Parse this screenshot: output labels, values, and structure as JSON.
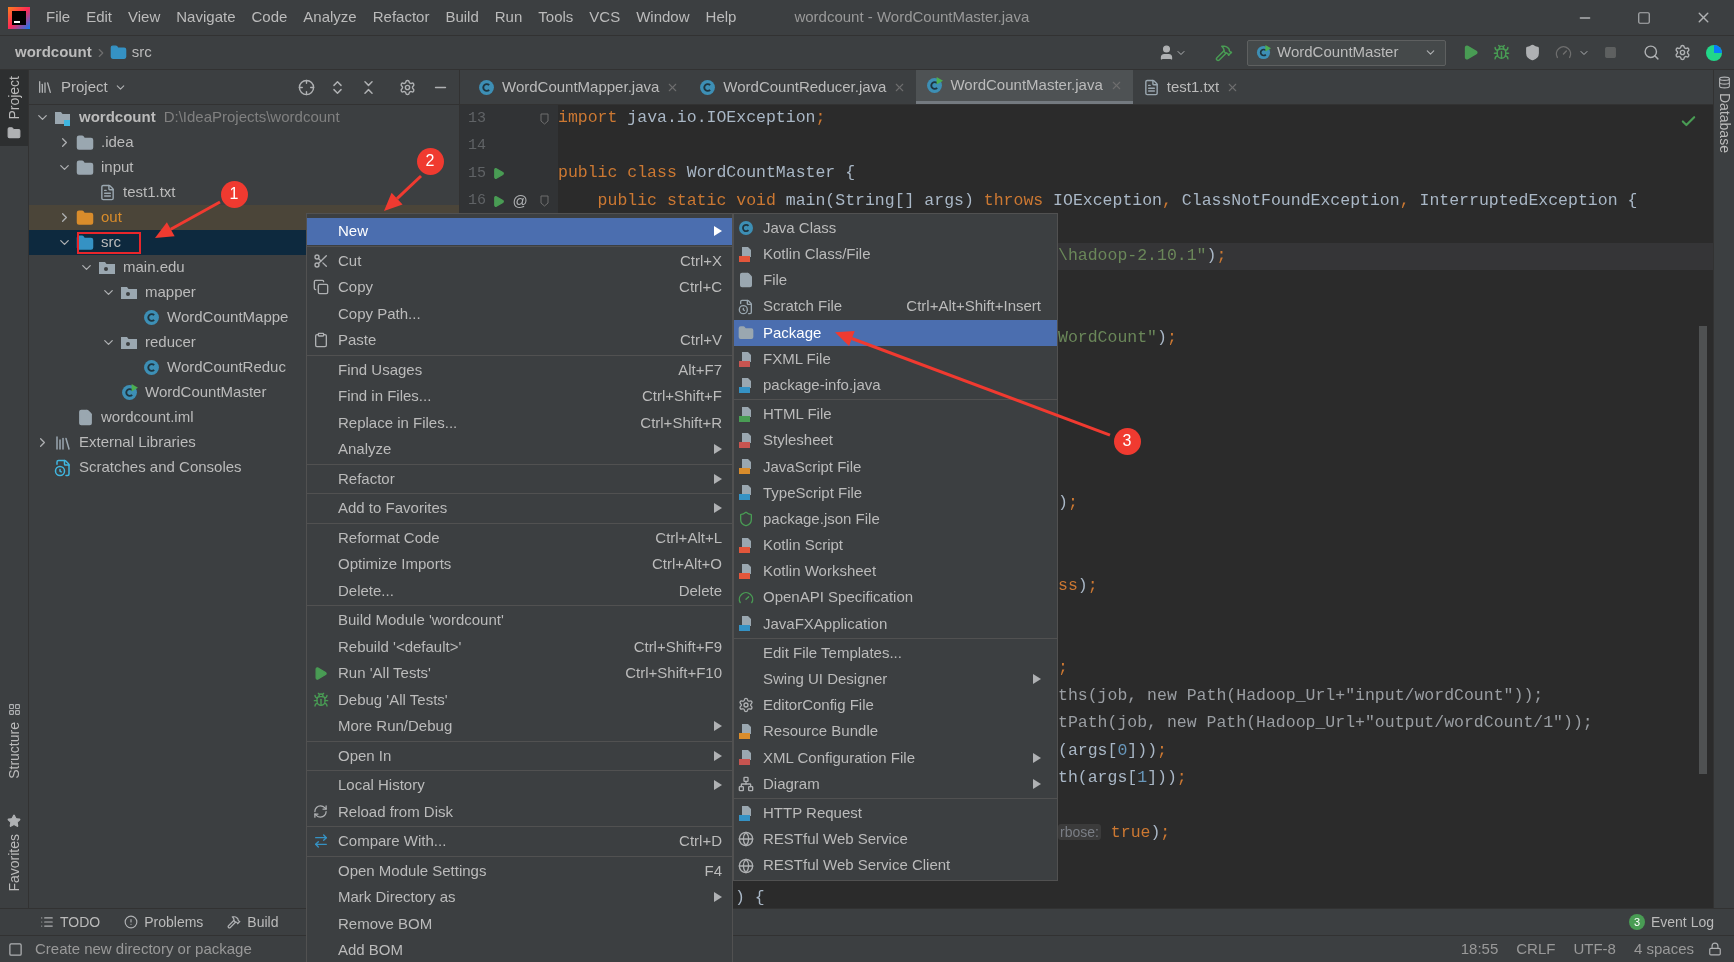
{
  "title_bar": {
    "menus": [
      "File",
      "Edit",
      "View",
      "Navigate",
      "Code",
      "Analyze",
      "Refactor",
      "Build",
      "Run",
      "Tools",
      "VCS",
      "Window",
      "Help"
    ],
    "title": "wordcount - WordCountMaster.java"
  },
  "nav_bar": {
    "breadcrumbs": [
      {
        "label": "wordcount",
        "kind": "project"
      },
      {
        "label": "src",
        "kind": "folder"
      }
    ],
    "run_config": "WordCountMaster"
  },
  "left_stripe": [
    {
      "label": "Project",
      "selected": true,
      "kind": "project"
    },
    {
      "label": "Structure",
      "selected": false,
      "kind": "structure"
    },
    {
      "label": "Favorites",
      "selected": false,
      "kind": "favorites"
    }
  ],
  "project_panel": {
    "title": "Project",
    "tree": [
      {
        "label": "wordcount",
        "path": "D:\\IdeaProjects\\wordcount",
        "kind": "module",
        "expanded": true,
        "selected": false,
        "children": [
          {
            "label": ".idea",
            "kind": "folder",
            "expanded": false,
            "selected": false
          },
          {
            "label": "input",
            "kind": "folder",
            "expanded": true,
            "selected": false,
            "children": [
              {
                "label": "test1.txt",
                "kind": "text",
                "selected": false
              }
            ]
          },
          {
            "label": "out",
            "kind": "excluded",
            "expanded": false,
            "selected": false
          },
          {
            "label": "src",
            "kind": "source",
            "expanded": true,
            "selected": true,
            "children": [
              {
                "label": "main.edu",
                "kind": "package",
                "expanded": true,
                "selected": false,
                "children": [
                  {
                    "label": "mapper",
                    "kind": "package",
                    "expanded": true,
                    "selected": false,
                    "children": [
                      {
                        "label": "WordCountMappe",
                        "kind": "class",
                        "selected": false
                      }
                    ]
                  },
                  {
                    "label": "reducer",
                    "kind": "package",
                    "expanded": true,
                    "selected": false,
                    "children": [
                      {
                        "label": "WordCountReduc",
                        "kind": "class",
                        "selected": false
                      }
                    ]
                  },
                  {
                    "label": "WordCountMaster",
                    "kind": "runclass",
                    "selected": false
                  }
                ]
              }
            ]
          },
          {
            "label": "wordcount.iml",
            "kind": "iml",
            "selected": false
          }
        ]
      },
      {
        "label": "External Libraries",
        "kind": "libraries",
        "expanded": false,
        "selected": false
      },
      {
        "label": "Scratches and Consoles",
        "kind": "scratches",
        "selected": false
      }
    ]
  },
  "editor_tabs": [
    {
      "label": "WordCountMapper.java",
      "kind": "class",
      "selected": false
    },
    {
      "label": "WordCountReducer.java",
      "kind": "class",
      "selected": false
    },
    {
      "label": "WordCountMaster.java",
      "kind": "runclass",
      "selected": true
    },
    {
      "label": "test1.txt",
      "kind": "text",
      "selected": false
    }
  ],
  "code_lines": [
    {
      "number": "13",
      "kind": "full",
      "fold": true,
      "tokens": [
        {
          "kind": "kw",
          "t": "import"
        },
        {
          "kind": "plain",
          "t": " java.io.IOException"
        },
        {
          "kind": "kw",
          "t": ";"
        }
      ]
    },
    {
      "number": "14",
      "kind": "full"
    },
    {
      "number": "15",
      "kind": "full",
      "run": true,
      "tokens": [
        {
          "kind": "kw",
          "t": "public class"
        },
        {
          "kind": "plain",
          "t": " WordCountMaster {"
        }
      ]
    },
    {
      "number": "16",
      "kind": "full",
      "run": true,
      "mark": "@",
      "fold": true,
      "tokens": [
        {
          "kind": "kw",
          "t": "    public static void"
        },
        {
          "kind": "plain",
          "t": " main(String[] args) "
        },
        {
          "kind": "kw",
          "t": "throws"
        },
        {
          "kind": "plain",
          "t": " IOException"
        },
        {
          "kind": "kw",
          "t": ","
        },
        {
          "kind": "plain",
          "t": " ClassNotFoundException"
        },
        {
          "kind": "kw",
          "t": ","
        },
        {
          "kind": "plain",
          "t": " InterruptedException {"
        }
      ]
    },
    {
      "kind": "hidden"
    },
    {
      "kind": "cut",
      "current": true,
      "tokens": [
        {
          "kind": "str",
          "t": "\\hadoop-2.10.1\""
        },
        {
          "kind": "plain",
          "t": ")"
        },
        {
          "kind": "kw",
          "t": ";"
        }
      ]
    },
    {
      "kind": "hidden"
    },
    {
      "kind": "hidden"
    },
    {
      "kind": "cut",
      "tokens": [
        {
          "kind": "str",
          "t": "WordCount\""
        },
        {
          "kind": "plain",
          "t": ")"
        },
        {
          "kind": "kw",
          "t": ";"
        }
      ]
    },
    {
      "kind": "hidden"
    },
    {
      "kind": "hidden"
    },
    {
      "kind": "hidden"
    },
    {
      "kind": "hidden"
    },
    {
      "kind": "hidden"
    },
    {
      "kind": "cut",
      "tokens": [
        {
          "kind": "plain",
          "t": ")"
        },
        {
          "kind": "kw",
          "t": ";"
        }
      ]
    },
    {
      "kind": "hidden"
    },
    {
      "kind": "hidden"
    },
    {
      "kind": "cut",
      "tokens": [
        {
          "kind": "kw",
          "t": "ss"
        },
        {
          "kind": "plain",
          "t": ")"
        },
        {
          "kind": "kw",
          "t": ";"
        }
      ]
    },
    {
      "kind": "hidden"
    },
    {
      "kind": "hidden"
    },
    {
      "kind": "cut",
      "tokens": [
        {
          "kind": "kw",
          "t": ";"
        }
      ]
    },
    {
      "kind": "cut",
      "tokens": [
        {
          "kind": "dim",
          "t": "ths(job, new Path(Hadoop_Url+\"input/wordCount\"));"
        }
      ]
    },
    {
      "kind": "cut",
      "tokens": [
        {
          "kind": "dim",
          "t": "tPath(job, new Path(Hadoop_Url+\"output/wordCount/1\"));"
        }
      ]
    },
    {
      "kind": "cut",
      "tokens": [
        {
          "kind": "plain",
          "t": "(args["
        },
        {
          "kind": "num",
          "t": "0"
        },
        {
          "kind": "plain",
          "t": "]))"
        },
        {
          "kind": "kw",
          "t": ";"
        }
      ]
    },
    {
      "kind": "cut",
      "tokens": [
        {
          "kind": "plain",
          "t": "th(args["
        },
        {
          "kind": "num",
          "t": "1"
        },
        {
          "kind": "plain",
          "t": "]))"
        },
        {
          "kind": "kw",
          "t": ";"
        }
      ]
    },
    {
      "kind": "hidden"
    },
    {
      "kind": "cut",
      "tokens": [
        {
          "kind": "hint",
          "t": "rbose:"
        },
        {
          "kind": "kw",
          "t": " true"
        },
        {
          "kind": "plain",
          "t": ")"
        },
        {
          "kind": "kw",
          "t": ";"
        }
      ]
    },
    {
      "kind": "hidden"
    },
    {
      "kind": "cut_low",
      "tokens": [
        {
          "kind": "plain",
          "t": ") {"
        }
      ]
    }
  ],
  "context_menu": {
    "groups": [
      {
        "items": [
          {
            "label": "New",
            "submenu": true,
            "selected": true
          }
        ]
      },
      {
        "items": [
          {
            "label": "Cut",
            "shortcut": "Ctrl+X",
            "kind": "cut",
            "selected": false
          },
          {
            "label": "Copy",
            "shortcut": "Ctrl+C",
            "kind": "copy",
            "selected": false
          },
          {
            "label": "Copy Path...",
            "selected": false
          },
          {
            "label": "Paste",
            "shortcut": "Ctrl+V",
            "kind": "paste",
            "selected": false
          }
        ]
      },
      {
        "items": [
          {
            "label": "Find Usages",
            "shortcut": "Alt+F7",
            "selected": false
          },
          {
            "label": "Find in Files...",
            "shortcut": "Ctrl+Shift+F",
            "selected": false
          },
          {
            "label": "Replace in Files...",
            "shortcut": "Ctrl+Shift+R",
            "selected": false
          },
          {
            "label": "Analyze",
            "submenu": true,
            "selected": false
          }
        ]
      },
      {
        "items": [
          {
            "label": "Refactor",
            "submenu": true,
            "selected": false
          }
        ]
      },
      {
        "items": [
          {
            "label": "Add to Favorites",
            "submenu": true,
            "selected": false
          }
        ]
      },
      {
        "items": [
          {
            "label": "Reformat Code",
            "shortcut": "Ctrl+Alt+L",
            "selected": false
          },
          {
            "label": "Optimize Imports",
            "shortcut": "Ctrl+Alt+O",
            "selected": false
          },
          {
            "label": "Delete...",
            "shortcut": "Delete",
            "selected": false
          }
        ]
      },
      {
        "items": [
          {
            "label": "Build Module 'wordcount'",
            "selected": false
          },
          {
            "label": "Rebuild '<default>'",
            "shortcut": "Ctrl+Shift+F9",
            "selected": false
          },
          {
            "label": "Run 'All Tests'",
            "shortcut": "Ctrl+Shift+F10",
            "kind": "run",
            "selected": false
          },
          {
            "label": "Debug 'All Tests'",
            "kind": "debug",
            "selected": false
          },
          {
            "label": "More Run/Debug",
            "submenu": true,
            "selected": false
          }
        ]
      },
      {
        "items": [
          {
            "label": "Open In",
            "submenu": true,
            "selected": false
          }
        ]
      },
      {
        "items": [
          {
            "label": "Local History",
            "submenu": true,
            "selected": false
          },
          {
            "label": "Reload from Disk",
            "kind": "reload",
            "selected": false
          }
        ]
      },
      {
        "items": [
          {
            "label": "Compare With...",
            "shortcut": "Ctrl+D",
            "kind": "compare",
            "selected": false
          }
        ]
      },
      {
        "items": [
          {
            "label": "Open Module Settings",
            "shortcut": "F4",
            "selected": false
          },
          {
            "label": "Mark Directory as",
            "submenu": true,
            "selected": false
          },
          {
            "label": "Remove BOM",
            "selected": false
          },
          {
            "label": "Add BOM",
            "selected": false
          }
        ]
      }
    ]
  },
  "submenu": {
    "groups": [
      {
        "items": [
          {
            "label": "Java Class",
            "kind": "class",
            "selected": false
          },
          {
            "label": "Kotlin Class/File",
            "kind": "kotlin",
            "selected": false
          },
          {
            "label": "File",
            "kind": "file",
            "selected": false
          },
          {
            "label": "Scratch File",
            "shortcut": "Ctrl+Alt+Shift+Insert",
            "kind": "scratch",
            "selected": false
          },
          {
            "label": "Package",
            "kind": "package",
            "selected": true
          },
          {
            "label": "FXML File",
            "kind": "fxml",
            "selected": false
          },
          {
            "label": "package-info.java",
            "kind": "javafile",
            "selected": false
          }
        ]
      },
      {
        "items": [
          {
            "label": "HTML File",
            "kind": "html",
            "selected": false
          },
          {
            "label": "Stylesheet",
            "kind": "css",
            "selected": false
          },
          {
            "label": "JavaScript File",
            "kind": "js",
            "selected": false
          },
          {
            "label": "TypeScript File",
            "kind": "ts",
            "selected": false
          },
          {
            "label": "package.json File",
            "kind": "npm",
            "selected": false
          },
          {
            "label": "Kotlin Script",
            "kind": "kotlin",
            "selected": false
          },
          {
            "label": "Kotlin Worksheet",
            "kind": "kotlin",
            "selected": false
          },
          {
            "label": "OpenAPI Specification",
            "kind": "openapi",
            "selected": false
          },
          {
            "label": "JavaFXApplication",
            "kind": "javafile",
            "selected": false
          }
        ]
      },
      {
        "items": [
          {
            "label": "Edit File Templates...",
            "selected": false
          },
          {
            "label": "Swing UI Designer",
            "submenu": true,
            "selected": false
          },
          {
            "label": "EditorConfig File",
            "kind": "gear",
            "selected": false
          },
          {
            "label": "Resource Bundle",
            "kind": "bundle",
            "selected": false
          },
          {
            "label": "XML Configuration File",
            "submenu": true,
            "kind": "fxml",
            "selected": false
          },
          {
            "label": "Diagram",
            "submenu": true,
            "kind": "diagram",
            "selected": false
          }
        ]
      },
      {
        "items": [
          {
            "label": "HTTP Request",
            "kind": "api",
            "selected": false
          },
          {
            "label": "RESTful Web Service",
            "kind": "web",
            "selected": false
          },
          {
            "label": "RESTful Web Service Client",
            "kind": "web",
            "selected": false
          }
        ]
      }
    ]
  },
  "right_stripe": [
    {
      "label": "Database"
    }
  ],
  "bottom_tools": [
    {
      "label": "TODO",
      "kind": "todo"
    },
    {
      "label": "Problems",
      "kind": "problems"
    },
    {
      "label": "Build",
      "kind": "build"
    }
  ],
  "event_log": {
    "count": "3",
    "label": "Event Log"
  },
  "status_bar": {
    "message": "Create new directory or package",
    "items": [
      "18:55",
      "CRLF",
      "UTF-8",
      "4 spaces"
    ]
  },
  "annotations": [
    {
      "label": "1"
    },
    {
      "label": "2"
    },
    {
      "label": "3"
    }
  ]
}
